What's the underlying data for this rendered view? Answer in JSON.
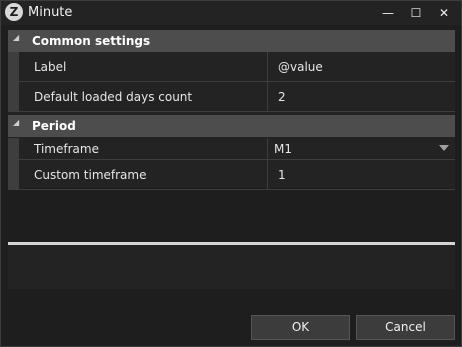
{
  "window": {
    "title": "Minute",
    "app_icon_glyph": "Z",
    "minimize_glyph": "—",
    "maximize_glyph": "☐",
    "close_glyph": "✕"
  },
  "categories": [
    {
      "label": "Common settings",
      "expanded": true,
      "properties": [
        {
          "name": "Label",
          "value": "@value"
        },
        {
          "name": "Default loaded days count",
          "value": "2"
        }
      ]
    },
    {
      "label": "Period",
      "expanded": true,
      "properties": [
        {
          "name": "Timeframe",
          "value": "M1"
        },
        {
          "name": "Custom timeframe",
          "value": "1"
        }
      ]
    }
  ],
  "buttons": {
    "ok": "OK",
    "cancel": "Cancel"
  },
  "icons": {
    "expanded_arrow": "◢",
    "dropdown": "chevron-down-icon"
  },
  "colors": {
    "background": "#1e1e1e",
    "category_header": "#4d4d4d",
    "splitter": "#d4d4d4"
  }
}
